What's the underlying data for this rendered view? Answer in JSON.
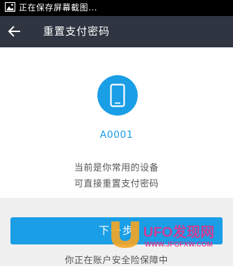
{
  "status_bar": {
    "text": "正在保存屏幕截图..."
  },
  "nav": {
    "title": "重置支付密码"
  },
  "device": {
    "id": "A0001",
    "desc_line1": "当前是你常用的设备",
    "desc_line2": "可直接重置支付密码"
  },
  "actions": {
    "next_label": "下一步"
  },
  "footer": {
    "security_text": "你正在账户安全险保障中"
  },
  "watermark": {
    "brand": "UFO发现网",
    "url": "WWW.JFOFXW.COM"
  },
  "colors": {
    "accent": "#1a9ee6",
    "nav_bg": "#2f3541"
  }
}
